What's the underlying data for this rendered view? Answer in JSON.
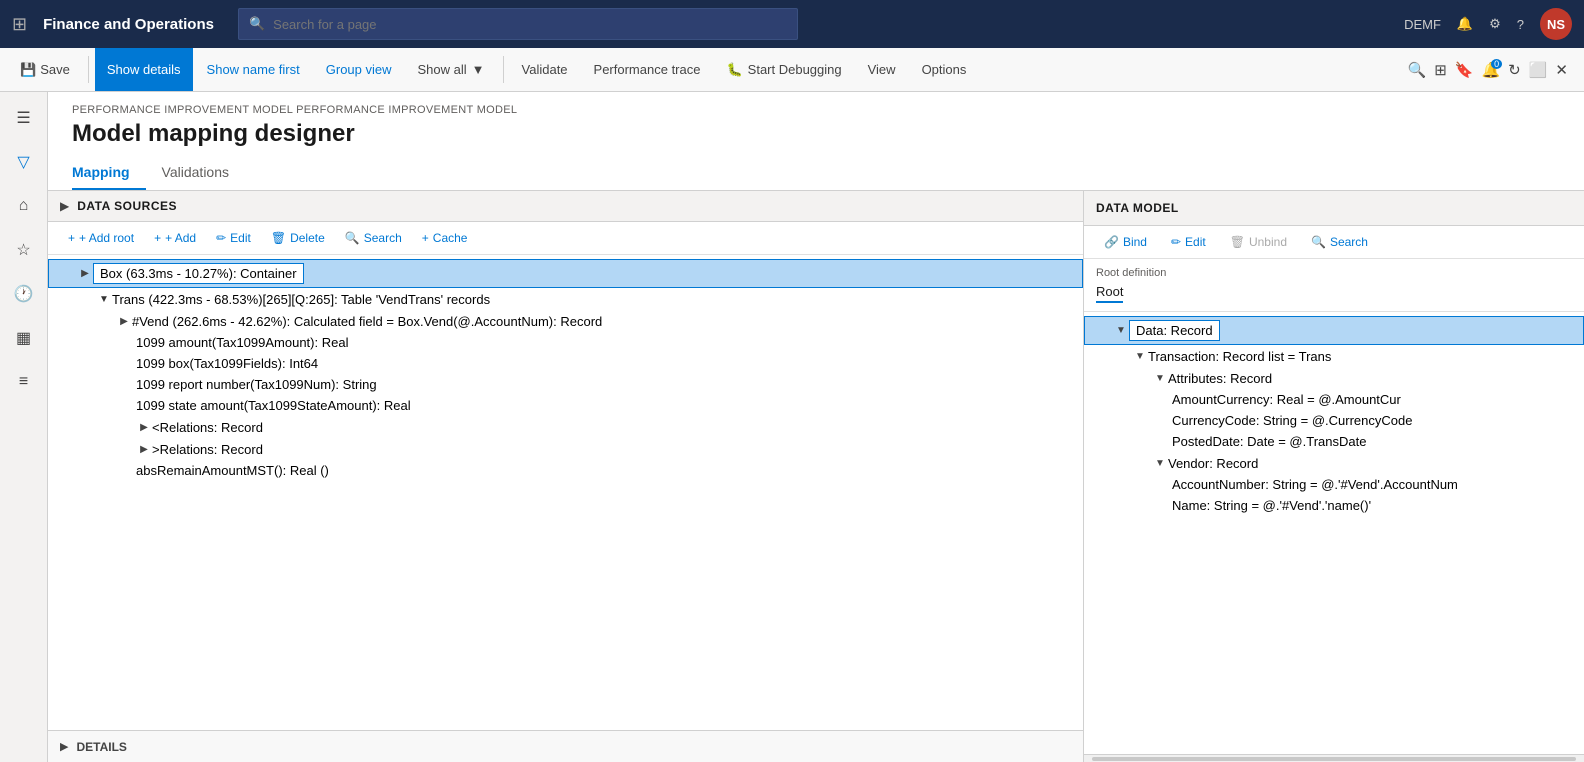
{
  "app": {
    "title": "Finance and Operations",
    "search_placeholder": "Search for a page",
    "user": "NS",
    "environment": "DEMF"
  },
  "toolbar": {
    "save_label": "Save",
    "show_details_label": "Show details",
    "show_name_first_label": "Show name first",
    "group_view_label": "Group view",
    "show_all_label": "Show all",
    "validate_label": "Validate",
    "performance_trace_label": "Performance trace",
    "start_debugging_label": "Start Debugging",
    "view_label": "View",
    "options_label": "Options"
  },
  "page": {
    "breadcrumb": "PERFORMANCE IMPROVEMENT MODEL PERFORMANCE IMPROVEMENT MODEL",
    "title": "Model mapping designer"
  },
  "tabs": [
    {
      "label": "Mapping",
      "active": true
    },
    {
      "label": "Validations",
      "active": false
    }
  ],
  "data_sources": {
    "panel_title": "DATA SOURCES",
    "add_root_label": "+ Add root",
    "add_label": "+ Add",
    "edit_label": "Edit",
    "delete_label": "Delete",
    "search_label": "Search",
    "cache_label": "Cache",
    "tree": [
      {
        "id": 1,
        "indent": 1,
        "label": "Box (63.3ms - 10.27%): Container",
        "selected": true,
        "has_children": true,
        "expanded": true
      },
      {
        "id": 2,
        "indent": 2,
        "label": "Trans (422.3ms - 68.53%)[265][Q:265]: Table 'VendTrans' records",
        "selected": false,
        "has_children": true,
        "expanded": true
      },
      {
        "id": 3,
        "indent": 3,
        "label": "#Vend (262.6ms - 42.62%): Calculated field = Box.Vend(@.AccountNum): Record",
        "selected": false,
        "has_children": true,
        "expanded": false
      },
      {
        "id": 4,
        "indent": 4,
        "label": "1099 amount(Tax1099Amount): Real",
        "selected": false
      },
      {
        "id": 5,
        "indent": 4,
        "label": "1099 box(Tax1099Fields): Int64",
        "selected": false
      },
      {
        "id": 6,
        "indent": 4,
        "label": "1099 report number(Tax1099Num): String",
        "selected": false
      },
      {
        "id": 7,
        "indent": 4,
        "label": "1099 state amount(Tax1099StateAmount): Real",
        "selected": false
      },
      {
        "id": 8,
        "indent": 4,
        "label": "<Relations: Record",
        "selected": false,
        "has_children": true,
        "expanded": false
      },
      {
        "id": 9,
        "indent": 4,
        "label": ">Relations: Record",
        "selected": false,
        "has_children": true,
        "expanded": false
      },
      {
        "id": 10,
        "indent": 4,
        "label": "absRemainAmountMST(): Real ()",
        "selected": false
      }
    ]
  },
  "data_model": {
    "panel_title": "DATA MODEL",
    "bind_label": "Bind",
    "edit_label": "Edit",
    "unbind_label": "Unbind",
    "search_label": "Search",
    "root_definition_label": "Root definition",
    "root_value": "Root",
    "tree": [
      {
        "id": 1,
        "indent": 1,
        "label": "Data: Record",
        "selected": true,
        "has_children": true,
        "expanded": true
      },
      {
        "id": 2,
        "indent": 2,
        "label": "Transaction: Record list = Trans",
        "selected": false,
        "has_children": true,
        "expanded": true
      },
      {
        "id": 3,
        "indent": 3,
        "label": "Attributes: Record",
        "selected": false,
        "has_children": true,
        "expanded": true
      },
      {
        "id": 4,
        "indent": 4,
        "label": "AmountCurrency: Real = @.AmountCur",
        "selected": false
      },
      {
        "id": 5,
        "indent": 4,
        "label": "CurrencyCode: String = @.CurrencyCode",
        "selected": false
      },
      {
        "id": 6,
        "indent": 4,
        "label": "PostedDate: Date = @.TransDate",
        "selected": false
      },
      {
        "id": 7,
        "indent": 3,
        "label": "Vendor: Record",
        "selected": false,
        "has_children": true,
        "expanded": true
      },
      {
        "id": 8,
        "indent": 4,
        "label": "AccountNumber: String = @.'#Vend'.AccountNum",
        "selected": false
      },
      {
        "id": 9,
        "indent": 4,
        "label": "Name: String = @.'#Vend'.'name()'",
        "selected": false
      }
    ]
  },
  "details": {
    "label": "DETAILS"
  },
  "icons": {
    "grid": "⊞",
    "search": "🔍",
    "save": "💾",
    "filter": "▼",
    "home": "⌂",
    "star": "☆",
    "clock": "🕐",
    "table": "⊡",
    "list": "≡",
    "expand": "▶",
    "collapse": "▼",
    "triangle_right": "▶",
    "triangle_down": "▼",
    "add": "+",
    "chain": "🔗",
    "pencil": "✏",
    "trash": "🗑",
    "magnify": "🔍",
    "cache": "⚡",
    "link": "🔗",
    "bug": "🐛"
  }
}
